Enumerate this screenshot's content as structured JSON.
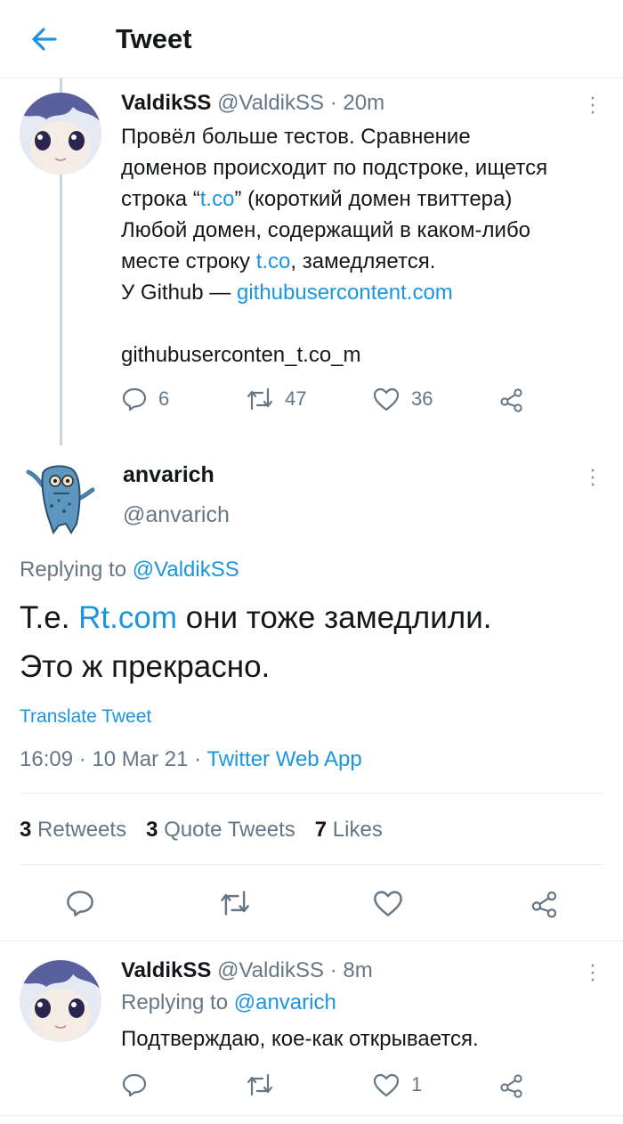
{
  "header": {
    "title": "Tweet"
  },
  "colors": {
    "accent": "#1b95e0",
    "muted": "#657786",
    "text": "#14171a",
    "divider": "#e6ecf0"
  },
  "parent_tweet": {
    "name": "ValdikSS",
    "handle": "@ValdikSS",
    "sep": "·",
    "time": "20m",
    "lines": [
      {
        "text": "Провёл больше тестов. Сравнение"
      },
      {
        "text": "доменов происходит по подстроке, ищется"
      },
      {
        "pre": "строка “",
        "link": "t.co",
        "post": "” (короткий домен твиттера)"
      },
      {
        "text": "Любой домен, содержащий в каком-либо"
      },
      {
        "pre": "месте строку ",
        "link": "t.co",
        "post": ", замедляется."
      },
      {
        "pre": "У Github — ",
        "link": "githubusercontent.com",
        "post": ""
      },
      {
        "text": "githubuserconten_t.co_m"
      }
    ],
    "replies": "6",
    "retweets": "47",
    "likes": "36",
    "icons": [
      "reply-icon",
      "retweet-icon",
      "like-icon",
      "share-icon",
      "more-icon"
    ]
  },
  "main_tweet": {
    "name": "anvarich",
    "handle": "@anvarich",
    "replying_prefix": "Replying to ",
    "replying_to": "@ValdikSS",
    "text_line1_pre": "Т.е. ",
    "text_line1_link": "Rt.com",
    "text_line1_post": " они тоже замедлили.",
    "text_line2": "Это ж прекрасно.",
    "translate": "Translate Tweet",
    "time": "16:09",
    "sep1": "·",
    "date": "10 Mar 21",
    "sep2": "·",
    "source": "Twitter Web App",
    "retweets_count": "3",
    "retweets_label": "Retweets",
    "quotes_count": "3",
    "quotes_label": "Quote Tweets",
    "likes_count": "7",
    "likes_label": "Likes"
  },
  "reply_tweet": {
    "name": "ValdikSS",
    "handle": "@ValdikSS",
    "sep": "·",
    "time": "8m",
    "replying_prefix": "Replying to ",
    "replying_to": "@anvarich",
    "text": "Подтверждаю, кое-как открывается.",
    "likes": "1"
  }
}
